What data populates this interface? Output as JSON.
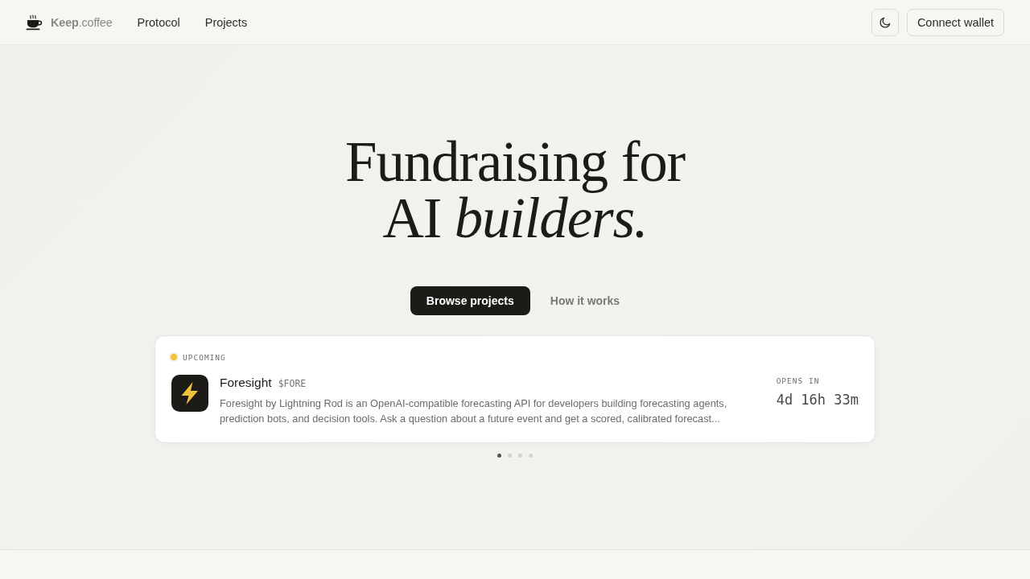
{
  "header": {
    "brand": "**Keep**.coffee",
    "nav": [
      {
        "label": "Protocol"
      },
      {
        "label": "Projects"
      }
    ],
    "connect_button": "Connect wallet"
  },
  "hero": {
    "headline_lines": [
      "Fundraising for",
      "AI *builders.*"
    ],
    "primary_button": "Browse projects",
    "secondary_button": "How it works"
  },
  "featured": {
    "slides": [
      {
        "status": {
          "kind": "upcoming",
          "label": "UPCOMING"
        },
        "name": "Foresight",
        "ticker": "$FORE",
        "description": "Foresight by Lightning Rod is an OpenAI-compatible forecasting API for developers building forecasting agents, prediction bots, and decision tools. Ask a question about a future event and get a scored, calibrated forecast...",
        "countdown_label": "OPENS IN",
        "countdown": "4d 16h 33m"
      }
    ],
    "dots": [
      {
        "selected": true
      },
      {
        "selected": false
      },
      {
        "selected": false
      },
      {
        "selected": false
      }
    ]
  }
}
